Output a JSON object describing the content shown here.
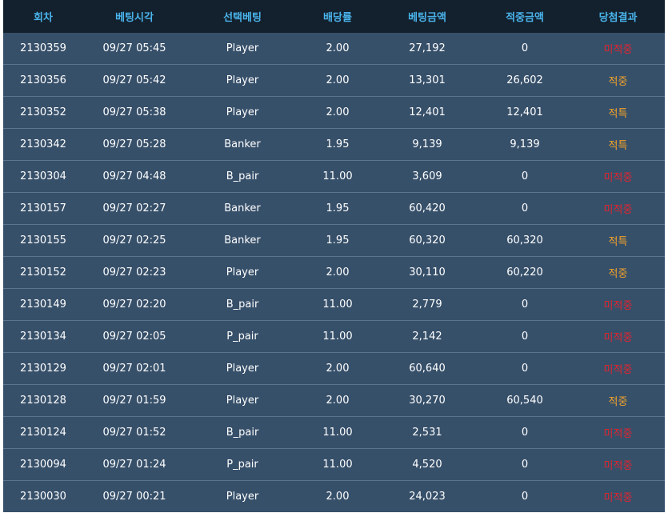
{
  "colors": {
    "header_bg": "#13202d",
    "header_text": "#4ab4ec",
    "row_bg": "#37506a",
    "win": "#f0a22a",
    "lose": "#e0252e"
  },
  "headers": [
    "회차",
    "베팅시각",
    "선택베팅",
    "배당률",
    "베팅금액",
    "적중금액",
    "당첨결과"
  ],
  "rows": [
    [
      "2130359",
      "09/27 05:45",
      "Player",
      "2.00",
      "27,192",
      "0",
      "미적중"
    ],
    [
      "2130356",
      "09/27 05:42",
      "Player",
      "2.00",
      "13,301",
      "26,602",
      "적중"
    ],
    [
      "2130352",
      "09/27 05:38",
      "Player",
      "2.00",
      "12,401",
      "12,401",
      "적특"
    ],
    [
      "2130342",
      "09/27 05:28",
      "Banker",
      "1.95",
      "9,139",
      "9,139",
      "적특"
    ],
    [
      "2130304",
      "09/27 04:48",
      "B_pair",
      "11.00",
      "3,609",
      "0",
      "미적중"
    ],
    [
      "2130157",
      "09/27 02:27",
      "Banker",
      "1.95",
      "60,420",
      "0",
      "미적중"
    ],
    [
      "2130155",
      "09/27 02:25",
      "Banker",
      "1.95",
      "60,320",
      "60,320",
      "적특"
    ],
    [
      "2130152",
      "09/27 02:23",
      "Player",
      "2.00",
      "30,110",
      "60,220",
      "적중"
    ],
    [
      "2130149",
      "09/27 02:20",
      "B_pair",
      "11.00",
      "2,779",
      "0",
      "미적중"
    ],
    [
      "2130134",
      "09/27 02:05",
      "P_pair",
      "11.00",
      "2,142",
      "0",
      "미적중"
    ],
    [
      "2130129",
      "09/27 02:01",
      "Player",
      "2.00",
      "60,640",
      "0",
      "미적중"
    ],
    [
      "2130128",
      "09/27 01:59",
      "Player",
      "2.00",
      "30,270",
      "60,540",
      "적중"
    ],
    [
      "2130124",
      "09/27 01:52",
      "B_pair",
      "11.00",
      "2,531",
      "0",
      "미적중"
    ],
    [
      "2130094",
      "09/27 01:24",
      "P_pair",
      "11.00",
      "4,520",
      "0",
      "미적중"
    ],
    [
      "2130030",
      "09/27 00:21",
      "Player",
      "2.00",
      "24,023",
      "0",
      "미적중"
    ]
  ]
}
